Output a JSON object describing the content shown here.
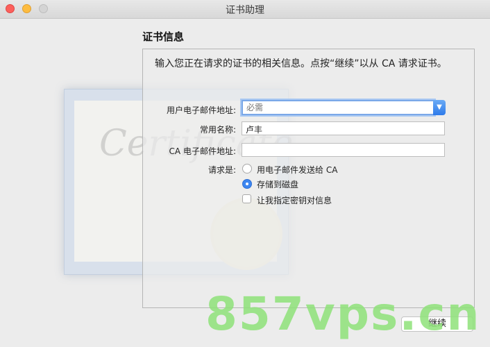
{
  "window": {
    "title": "证书助理"
  },
  "section": {
    "title": "证书信息",
    "intro": "输入您正在请求的证书的相关信息。点按“继续”以从 CA 请求证书。"
  },
  "certificate_art": {
    "script_text": "Certificate"
  },
  "form": {
    "email_label": "用户电子邮件地址:",
    "email_placeholder": "必需",
    "email_value": "",
    "common_name_label": "常用名称:",
    "common_name_value": "卢丰",
    "ca_email_label": "CA 电子邮件地址:",
    "ca_email_value": "",
    "request_label": "请求是:",
    "options": {
      "email_to_ca": "用电子邮件发送给 CA",
      "save_to_disk": "存储到磁盘",
      "specify_key": "让我指定密钥对信息"
    },
    "selected_option": "save_to_disk",
    "specify_key_checked": false
  },
  "buttons": {
    "continue": "继续"
  },
  "watermark": {
    "text": "857vps.cn"
  },
  "colors": {
    "accent": "#3d86f0",
    "watermark": "#8fe27a"
  }
}
